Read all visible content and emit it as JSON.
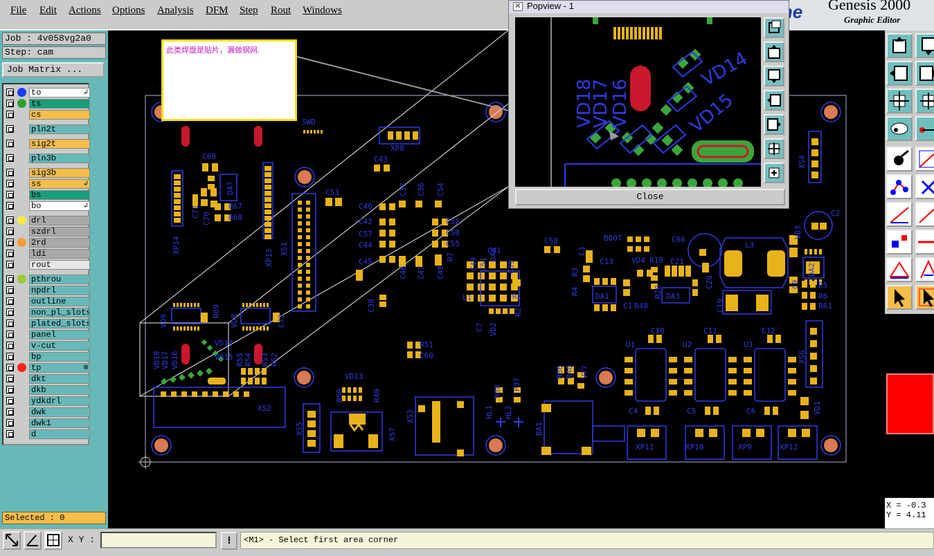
{
  "menubar": {
    "items": [
      "File",
      "Edit",
      "Actions",
      "Options",
      "Analysis",
      "DFM",
      "Step",
      "Rout",
      "Windows"
    ]
  },
  "brand": {
    "logo": "Frontline",
    "title": "Genesis 2000",
    "subtitle": "Graphic Editor"
  },
  "job": {
    "label": "Job : 4v058vg2a0",
    "step": "Step: cam",
    "matrix_button": "Job Matrix ..."
  },
  "layers": [
    {
      "name": "to",
      "bg": "#ffffff",
      "dot": "#1a3cff",
      "mark": "↲"
    },
    {
      "name": "ts",
      "bg": "#179f7d",
      "dot": "#2f9e2f",
      "mark": ""
    },
    {
      "name": "cs",
      "bg": "#f5bd4a",
      "dot": "",
      "mark": ""
    },
    {
      "name": "pln2t",
      "bg": "#67b9b9",
      "dot": "",
      "mark": ""
    },
    {
      "name": "sig2t",
      "bg": "#f5bd4a",
      "dot": "",
      "mark": ""
    },
    {
      "name": "pln3b",
      "bg": "#67b9b9",
      "dot": "",
      "mark": ""
    },
    {
      "name": "sig3b",
      "bg": "#f5bd4a",
      "dot": "",
      "mark": ""
    },
    {
      "name": "ss",
      "bg": "#f5bd4a",
      "dot": "",
      "mark": "↲"
    },
    {
      "name": "bs",
      "bg": "#179f7d",
      "dot": "",
      "mark": ""
    },
    {
      "name": "bo",
      "bg": "#ffffff",
      "dot": "",
      "mark": "↲"
    },
    {
      "name": "drl",
      "bg": "#a9a9a9",
      "dot": "#f7e84a",
      "mark": ""
    },
    {
      "name": "szdrl",
      "bg": "#a9a9a9",
      "dot": "",
      "mark": ""
    },
    {
      "name": "2rd",
      "bg": "#a9a9a9",
      "dot": "#f59a3a",
      "mark": ""
    },
    {
      "name": "ldi",
      "bg": "#a9a9a9",
      "dot": "",
      "mark": ""
    },
    {
      "name": "rout",
      "bg": "#e6e6e6",
      "dot": "",
      "mark": ""
    },
    {
      "name": "pthrou",
      "bg": "#67b9b9",
      "dot": "#9ec93a",
      "mark": ""
    },
    {
      "name": "npdrl",
      "bg": "#67b9b9",
      "dot": "",
      "mark": ""
    },
    {
      "name": "outline",
      "bg": "#67b9b9",
      "dot": "",
      "mark": ""
    },
    {
      "name": "non_pl_slots",
      "bg": "#67b9b9",
      "dot": "",
      "mark": ""
    },
    {
      "name": "plated_slots",
      "bg": "#67b9b9",
      "dot": "",
      "mark": ""
    },
    {
      "name": "panel",
      "bg": "#67b9b9",
      "dot": "",
      "mark": ""
    },
    {
      "name": "v-cut",
      "bg": "#67b9b9",
      "dot": "",
      "mark": ""
    },
    {
      "name": "bp",
      "bg": "#67b9b9",
      "dot": "",
      "mark": ""
    },
    {
      "name": "tp",
      "bg": "#67b9b9",
      "dot": "#ff2020",
      "mark": "⊞"
    },
    {
      "name": "dkt",
      "bg": "#67b9b9",
      "dot": "",
      "mark": ""
    },
    {
      "name": "dkb",
      "bg": "#67b9b9",
      "dot": "",
      "mark": ""
    },
    {
      "name": "ydkdrl",
      "bg": "#67b9b9",
      "dot": "",
      "mark": ""
    },
    {
      "name": "dwk",
      "bg": "#67b9b9",
      "dot": "",
      "mark": ""
    },
    {
      "name": "dwk1",
      "bg": "#67b9b9",
      "dot": "",
      "mark": ""
    },
    {
      "name": "d",
      "bg": "#67b9b9",
      "dot": "",
      "mark": ""
    }
  ],
  "selected": "Selected : 0",
  "note": {
    "text": "此类焊盘是贴片，漏做钢网."
  },
  "popview": {
    "title": "Popview - 1",
    "close_label": "Close",
    "labels": [
      "VD18",
      "VD17",
      "VD16",
      "VD14",
      "VD15"
    ]
  },
  "pcb": {
    "labels": [
      "SWD",
      "XP8",
      "C69",
      "DA7",
      "C71",
      "C70",
      "R67",
      "R68",
      "XP14",
      "XP13",
      "XS1",
      "C43",
      "C53",
      "C37",
      "C36",
      "C54",
      "C40",
      "C42",
      "C57",
      "C44",
      "C45",
      "C46",
      "C47",
      "C48",
      "C52",
      "C50",
      "C55",
      "R7",
      "C38",
      "C49",
      "C51",
      "DA8",
      "C41",
      "C39",
      "L1",
      "C7",
      "VD2",
      "R1",
      "R2",
      "C58",
      "C3",
      "R3",
      "R4",
      "C13",
      "DA1",
      "BOOT",
      "VD4",
      "R19",
      "R20",
      "C66",
      "C21",
      "C19",
      "DA3",
      "C1",
      "R48",
      "L3",
      "C20",
      "DA2",
      "C2",
      "VD3",
      "R5",
      "R6",
      "R61",
      "C9",
      "XS4",
      "VD9",
      "R69",
      "VD8",
      "R68",
      "C73",
      "VD18",
      "VD17",
      "VD16",
      "VD14",
      "VD15",
      "R55",
      "R54",
      "R53",
      "R52",
      "XS2",
      "R51",
      "C60",
      "VD13",
      "R50",
      "R49",
      "XS5",
      "XS7",
      "XS3",
      "R38",
      "HL1",
      "HL2",
      "P37",
      "R36",
      "R40",
      "VT7",
      "BA1",
      "C10",
      "C11",
      "C12",
      "U1",
      "U2",
      "U3",
      "XS6",
      "C4",
      "C5",
      "C6",
      "XP11",
      "XP10",
      "XP9",
      "XP12",
      "VD1"
    ]
  },
  "bottom": {
    "xy_label": "X Y :",
    "status": "<M1> - Select first area corner",
    "coord_x": "X = -0.3",
    "coord_y": "Y = 4.11"
  }
}
